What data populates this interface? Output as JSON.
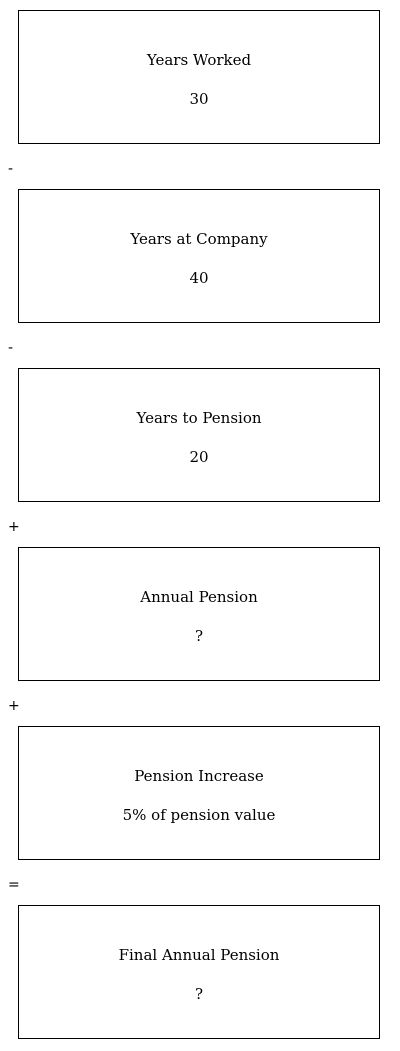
{
  "steps": [
    {
      "label": "Years Worked",
      "value": "30"
    },
    {
      "label": "Years at Company",
      "value": "40"
    },
    {
      "label": "Years to Pension",
      "value": "20"
    },
    {
      "label": "Annual Pension",
      "value": "?"
    },
    {
      "label": "Pension Increase",
      "value": "5% of pension value"
    },
    {
      "label": "Final Annual Pension",
      "value": "?"
    }
  ],
  "operators": [
    "-",
    "-",
    "+",
    "+",
    "="
  ]
}
